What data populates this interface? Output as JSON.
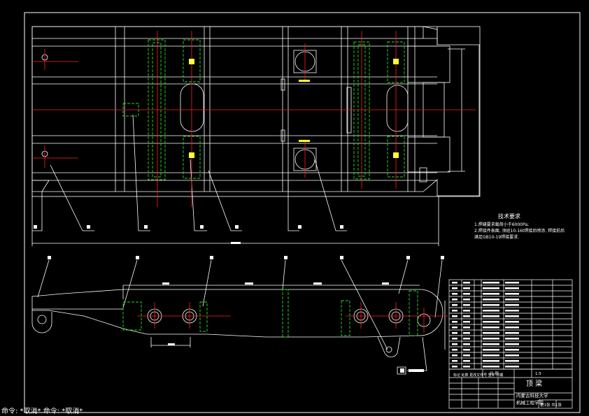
{
  "notes": {
    "heading": "技术要求",
    "lines": [
      "1.焊缝要求载荷小于6000Pa;",
      "2.焊接件表面, 须经10-16t焊接后喷涂, 焊接前后",
      "满足GB10-19焊接要求."
    ]
  },
  "title_block": {
    "part_name": "顶  梁",
    "school_line1": "内蒙古科技大学",
    "school_line2": "机械工程学院",
    "scale_label": "比 例",
    "sheet_label": "第1张 共1张",
    "misc": "1:5",
    "header_left": "标记 处数 更改文件号 签字 日期"
  },
  "status_bar": "命令: *取消* 命令: *取消*",
  "colors": {
    "background": "#000000",
    "line": "#ffffff",
    "center": "#ff2020",
    "hidden": "#22dd22",
    "accent": "#ffff33"
  }
}
